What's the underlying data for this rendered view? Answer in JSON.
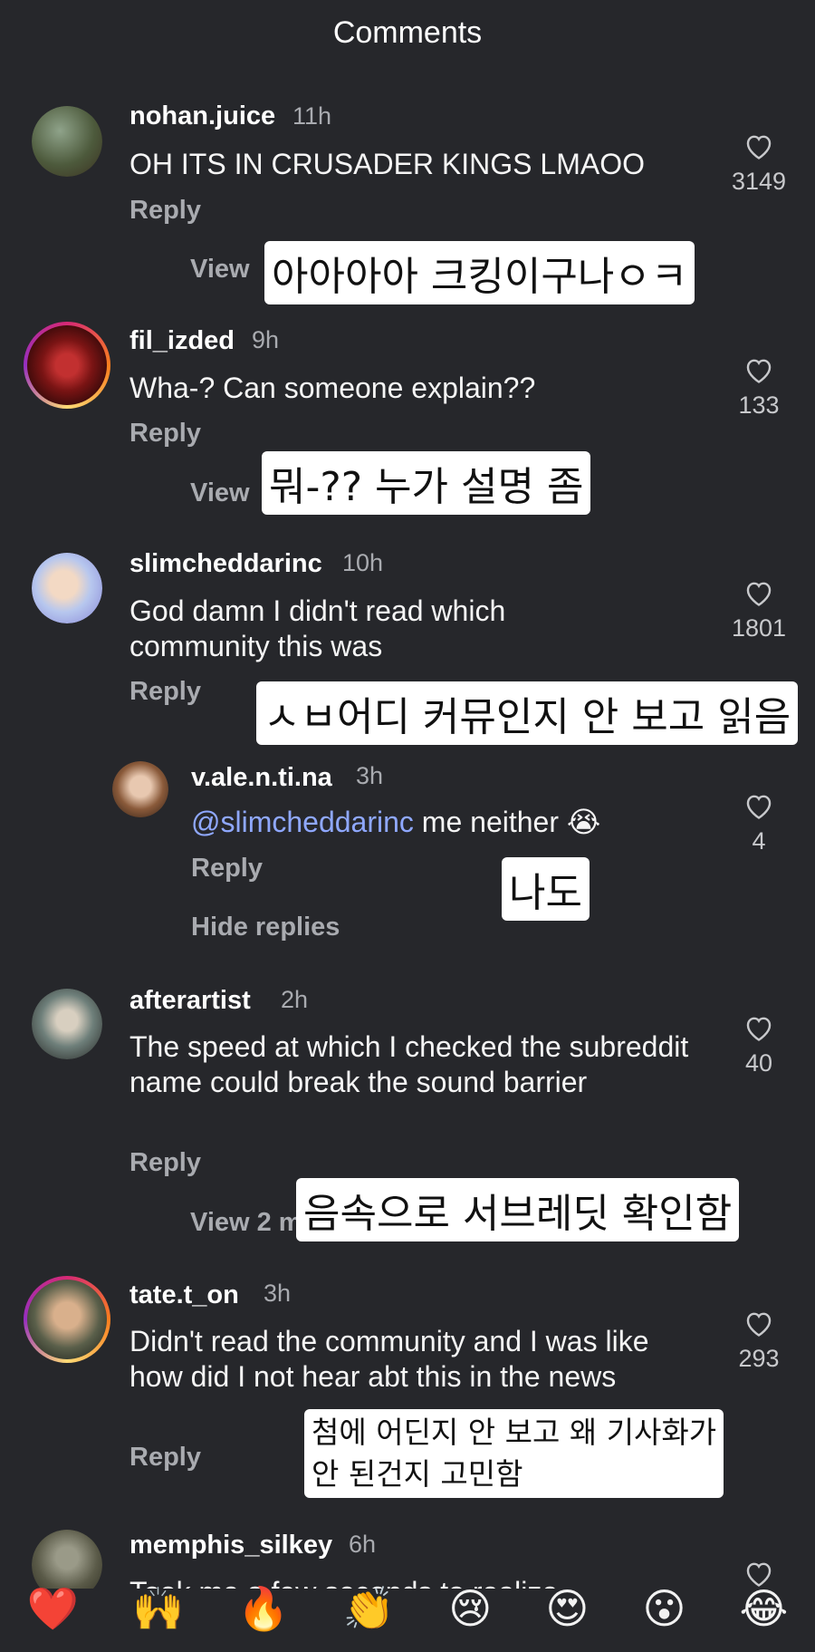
{
  "header": {
    "title": "Comments"
  },
  "comments": [
    {
      "user": "nohan.juice",
      "time": "11h",
      "text": "OH ITS IN CRUSADER KINGS LMAOO",
      "reply": "Reply",
      "likes": "3149",
      "view": "View",
      "overlay": "아아아아 크킹이구나ㅇㅋ"
    },
    {
      "user": "fil_izded",
      "time": "9h",
      "text": "Wha-? Can someone explain??",
      "reply": "Reply",
      "likes": "133",
      "view": "View",
      "overlay": "뭐-?? 누가 설명 좀"
    },
    {
      "user": "slimcheddarinc",
      "time": "10h",
      "text": "God damn I didn't read which community this was",
      "reply": "Reply",
      "likes": "1801",
      "overlay": "ㅅㅂ어디 커뮤인지 안 보고 읽음"
    },
    {
      "user": "v.ale.n.ti.na",
      "time": "3h",
      "mention": "@slimcheddarinc",
      "text": " me neither 😭",
      "reply": "Reply",
      "likes": "4",
      "overlay": "나도",
      "hide": "Hide replies"
    },
    {
      "user": "afterartist",
      "time": "2h",
      "text": "The speed at which I checked the subreddit name could break the sound barrier",
      "reply": "Reply",
      "likes": "40",
      "view": "View 2 m",
      "overlay": "음속으로 서브레딧 확인함"
    },
    {
      "user": "tate.t_on",
      "time": "3h",
      "text": "Didn't read the community and I was like how did I not hear abt this in the news",
      "reply": "Reply",
      "likes": "293",
      "overlay_line1": "첨에 어딘지 안 보고 왜 기사화가",
      "overlay_line2": "안 된건지 고민함"
    },
    {
      "user": "memphis_silkey",
      "time": "6h",
      "text": "Took me a few seconds to realize"
    }
  ],
  "emoji_bar": [
    "❤️",
    "🙌",
    "🔥",
    "👏",
    "😢",
    "😍",
    "😮",
    "😂"
  ],
  "colors": {
    "background": "#26272b",
    "mention": "#8fa8ff",
    "secondary": "#a9abb0"
  }
}
